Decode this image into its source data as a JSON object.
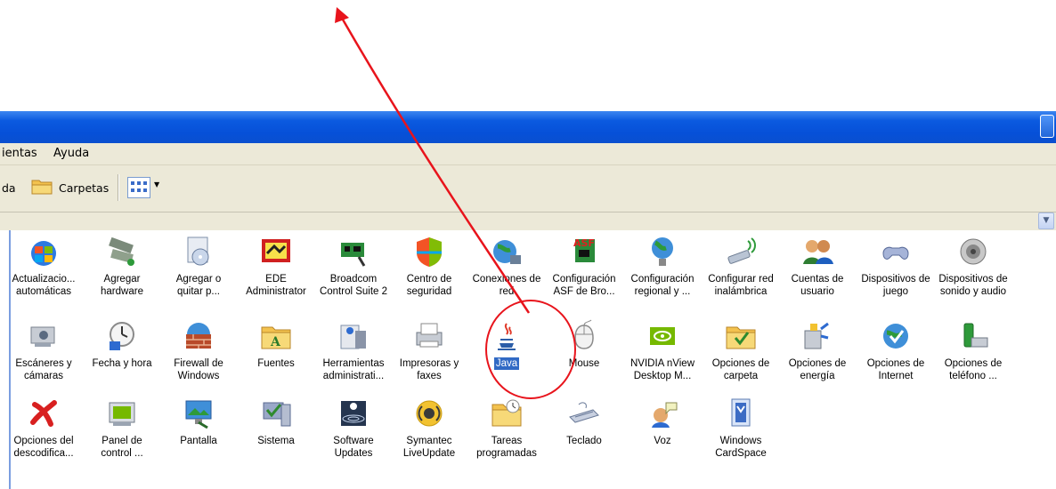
{
  "menubar": {
    "items": [
      "ientas",
      "Ayuda"
    ]
  },
  "toolbar": {
    "partial_label": "da",
    "folders_label": "Carpetas"
  },
  "icons": [
    {
      "l1": "Actualizacio...",
      "l2": "automáticas",
      "icon": "windows-update-icon"
    },
    {
      "l1": "Agregar",
      "l2": "hardware",
      "icon": "add-hardware-icon"
    },
    {
      "l1": "Agregar o",
      "l2": "quitar p...",
      "icon": "add-remove-programs-icon"
    },
    {
      "l1": "EDE",
      "l2": "Administrator",
      "icon": "ede-administrator-icon"
    },
    {
      "l1": "Broadcom",
      "l2": "Control Suite 2",
      "icon": "broadcom-icon"
    },
    {
      "l1": "Centro de",
      "l2": "seguridad",
      "icon": "security-center-icon"
    },
    {
      "l1": "Conexiones de",
      "l2": "red",
      "icon": "network-connections-icon"
    },
    {
      "l1": "Configuración",
      "l2": "ASF de Bro...",
      "icon": "asf-config-icon"
    },
    {
      "l1": "Configuración",
      "l2": "regional y ...",
      "icon": "regional-settings-icon"
    },
    {
      "l1": "Configurar red",
      "l2": "inalámbrica",
      "icon": "wireless-network-icon"
    },
    {
      "l1": "Cuentas de",
      "l2": "usuario",
      "icon": "user-accounts-icon"
    },
    {
      "l1": "Dispositivos de",
      "l2": "juego",
      "icon": "game-controllers-icon"
    },
    {
      "l1": "Dispositivos de",
      "l2": "sonido y audio",
      "icon": "sound-audio-icon"
    },
    {
      "l1": "Escáneres y",
      "l2": "cámaras",
      "icon": "scanners-cameras-icon"
    },
    {
      "l1": "Fecha y hora",
      "l2": "",
      "icon": "date-time-icon"
    },
    {
      "l1": "Firewall de",
      "l2": "Windows",
      "icon": "firewall-icon"
    },
    {
      "l1": "Fuentes",
      "l2": "",
      "icon": "fonts-folder-icon"
    },
    {
      "l1": "Herramientas",
      "l2": "administrati...",
      "icon": "admin-tools-icon"
    },
    {
      "l1": "Impresoras y",
      "l2": "faxes",
      "icon": "printers-faxes-icon"
    },
    {
      "l1": "Java",
      "l2": "",
      "icon": "java-icon",
      "selected": true
    },
    {
      "l1": "Mouse",
      "l2": "",
      "icon": "mouse-icon"
    },
    {
      "l1": "NVIDIA nView",
      "l2": "Desktop M...",
      "icon": "nvidia-nview-icon"
    },
    {
      "l1": "Opciones de",
      "l2": "carpeta",
      "icon": "folder-options-icon"
    },
    {
      "l1": "Opciones de",
      "l2": "energía",
      "icon": "power-options-icon"
    },
    {
      "l1": "Opciones de",
      "l2": "Internet",
      "icon": "internet-options-icon"
    },
    {
      "l1": "Opciones de",
      "l2": "teléfono ...",
      "icon": "phone-modem-icon"
    },
    {
      "l1": "Opciones del",
      "l2": "descodifica...",
      "icon": "decoder-options-icon"
    },
    {
      "l1": "Panel de",
      "l2": "control ...",
      "icon": "nvidia-control-panel-icon"
    },
    {
      "l1": "Pantalla",
      "l2": "",
      "icon": "display-icon"
    },
    {
      "l1": "Sistema",
      "l2": "",
      "icon": "system-icon"
    },
    {
      "l1": "Software",
      "l2": "Updates",
      "icon": "software-updates-icon"
    },
    {
      "l1": "Symantec",
      "l2": "LiveUpdate",
      "icon": "symantec-liveupdate-icon"
    },
    {
      "l1": "Tareas",
      "l2": "programadas",
      "icon": "scheduled-tasks-icon"
    },
    {
      "l1": "Teclado",
      "l2": "",
      "icon": "keyboard-icon"
    },
    {
      "l1": "Voz",
      "l2": "",
      "icon": "speech-icon"
    },
    {
      "l1": "Windows",
      "l2": "CardSpace",
      "icon": "cardspace-icon"
    }
  ],
  "colors": {
    "annotation": "#e8141c",
    "titlebar": "#0a5ae0",
    "selection": "#316ac5"
  }
}
